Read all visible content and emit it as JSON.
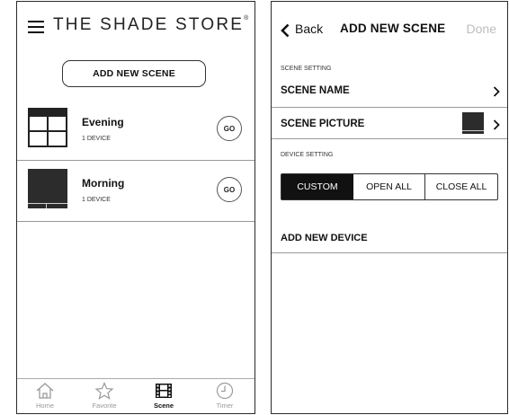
{
  "left_screen": {
    "brand": "THE SHADE STORE",
    "brand_mark": "®",
    "add_scene_button": "ADD NEW SCENE",
    "scenes": [
      {
        "name": "Evening",
        "devices": "1 DEVICE",
        "go": "GO",
        "picture": "window-grid-icon"
      },
      {
        "name": "Morning",
        "devices": "1 DEVICE",
        "go": "GO",
        "picture": "closed-shade-icon"
      }
    ],
    "tabs": [
      {
        "label": "Home",
        "icon": "home-icon",
        "active": false
      },
      {
        "label": "Favorite",
        "icon": "star-icon",
        "active": false
      },
      {
        "label": "Scene",
        "icon": "film-icon",
        "active": true
      },
      {
        "label": "Timer",
        "icon": "clock-icon",
        "active": false
      }
    ]
  },
  "right_screen": {
    "back_label": "Back",
    "title": "ADD NEW SCENE",
    "done_label": "Done",
    "scene_setting_header": "SCENE SETTING",
    "scene_name_label": "SCENE NAME",
    "scene_picture_label": "SCENE PICTURE",
    "device_setting_header": "DEVICE SETTING",
    "segments": [
      "CUSTOM",
      "OPEN ALL",
      "CLOSE ALL"
    ],
    "selected_segment": "CUSTOM",
    "add_device_label": "ADD NEW DEVICE"
  },
  "colors": {
    "accent": "#111111",
    "done_disabled": "#bdbdbd",
    "inactive_tab": "#999999"
  }
}
